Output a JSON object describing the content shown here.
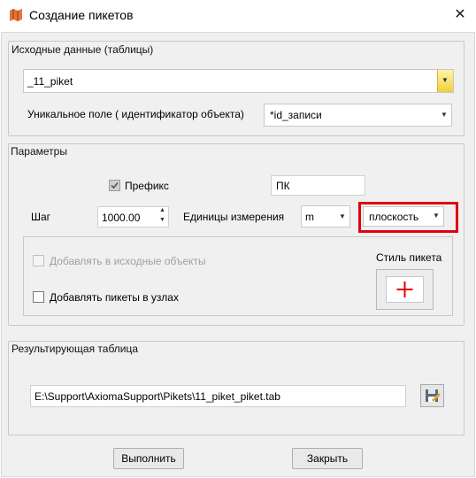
{
  "window": {
    "title": "Создание пикетов",
    "close_label": "✕"
  },
  "source": {
    "group_title": "Исходные данные (таблицы)",
    "table_value": "_11_piket",
    "unique_field_label": "Уникальное поле ( идентификатор объекта)",
    "unique_field_value": "*id_записи"
  },
  "params": {
    "group_title": "Параметры",
    "prefix_label": "Префикс",
    "prefix_checked": true,
    "prefix_value": "ПК",
    "step_label": "Шаг",
    "step_value": "1000.00",
    "units_label": "Единицы измерения",
    "units_value": "m",
    "plane_value": "плоскость",
    "highlight_color": "#e0000e",
    "add_to_source_label": "Добавлять в исходные объекты",
    "add_nodes_label": "Добавлять пикеты в узлах",
    "style_label": "Стиль пикета",
    "style_symbol": "+",
    "style_symbol_color": "#e00000"
  },
  "result": {
    "group_title": "Результирующая таблица",
    "path_value": "E:\\Support\\AxiomaSupport\\Pikets\\11_piket_piket.tab"
  },
  "buttons": {
    "run_label": "Выполнить",
    "close_label": "Закрыть"
  }
}
